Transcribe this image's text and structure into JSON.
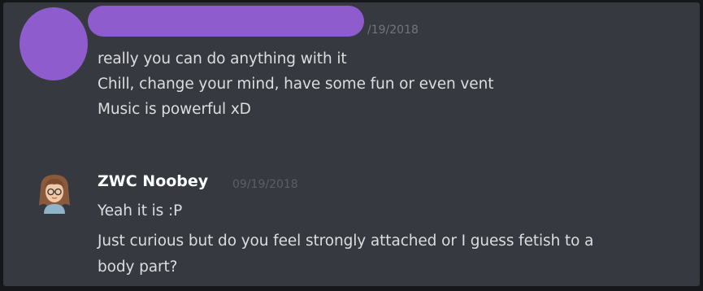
{
  "messages": [
    {
      "author": "",
      "timestamp": "/19/2018",
      "lines": [
        "really you can do anything with it",
        "Chill, change your mind, have some fun or even vent",
        "Music is powerful xD"
      ],
      "redaction_color": "#8e5ccc"
    },
    {
      "author": "ZWC Noobey",
      "timestamp": "09/19/2018",
      "avatar_icon": "cartoon-avatar-icon",
      "lines": [
        "Yeah it is :P",
        "Just curious but do you feel strongly attached or I guess fetish to a",
        "body part?"
      ]
    }
  ],
  "colors": {
    "background": "#36393f",
    "text": "#dcddde",
    "username": "#ffffff",
    "timestamp": "#72767d"
  }
}
